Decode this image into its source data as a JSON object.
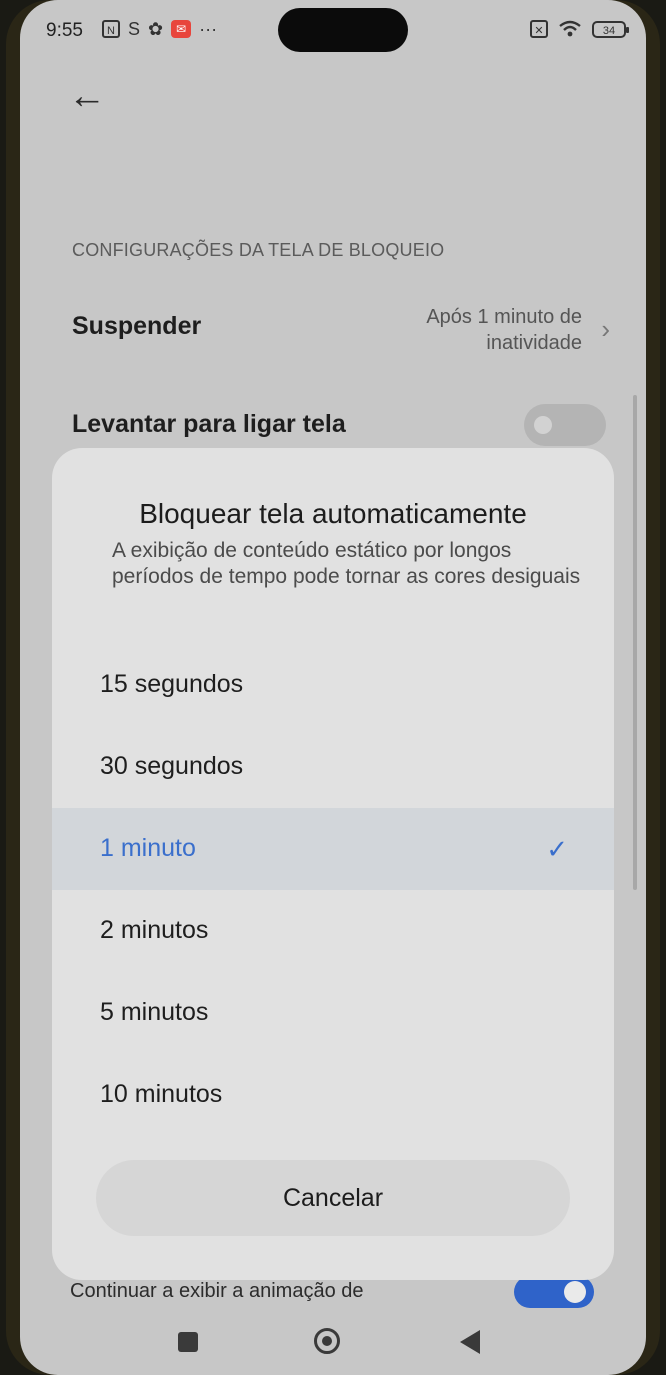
{
  "status_bar": {
    "time": "9:55",
    "battery": "34",
    "icons": [
      "nfc-icon",
      "s-icon",
      "gear-icon",
      "mail-icon",
      "more-icon",
      "no-sim-icon",
      "wifi-icon",
      "battery-icon"
    ]
  },
  "header": {
    "back_icon": "back-arrow-icon"
  },
  "section_title": "CONFIGURAÇÕES DA TELA DE BLOQUEIO",
  "settings": {
    "suspend": {
      "label": "Suspender",
      "value_line1": "Após 1 minuto de",
      "value_line2": "inatividade"
    },
    "raise_to_wake": {
      "label": "Levantar para ligar tela",
      "enabled": false
    },
    "continue_animation": {
      "label": "Continuar a exibir a animação de",
      "enabled": true
    }
  },
  "dialog": {
    "title": "Bloquear tela automaticamente",
    "description": "A exibição de conteúdo estático por longos períodos de tempo pode tornar as cores desiguais",
    "options": [
      {
        "label": "15 segundos",
        "selected": false
      },
      {
        "label": "30 segundos",
        "selected": false
      },
      {
        "label": "1 minuto",
        "selected": true
      },
      {
        "label": "2 minutos",
        "selected": false
      },
      {
        "label": "5 minutos",
        "selected": false
      },
      {
        "label": "10 minutos",
        "selected": false
      }
    ],
    "cancel_label": "Cancelar",
    "accent_color": "#3a6fcc"
  }
}
